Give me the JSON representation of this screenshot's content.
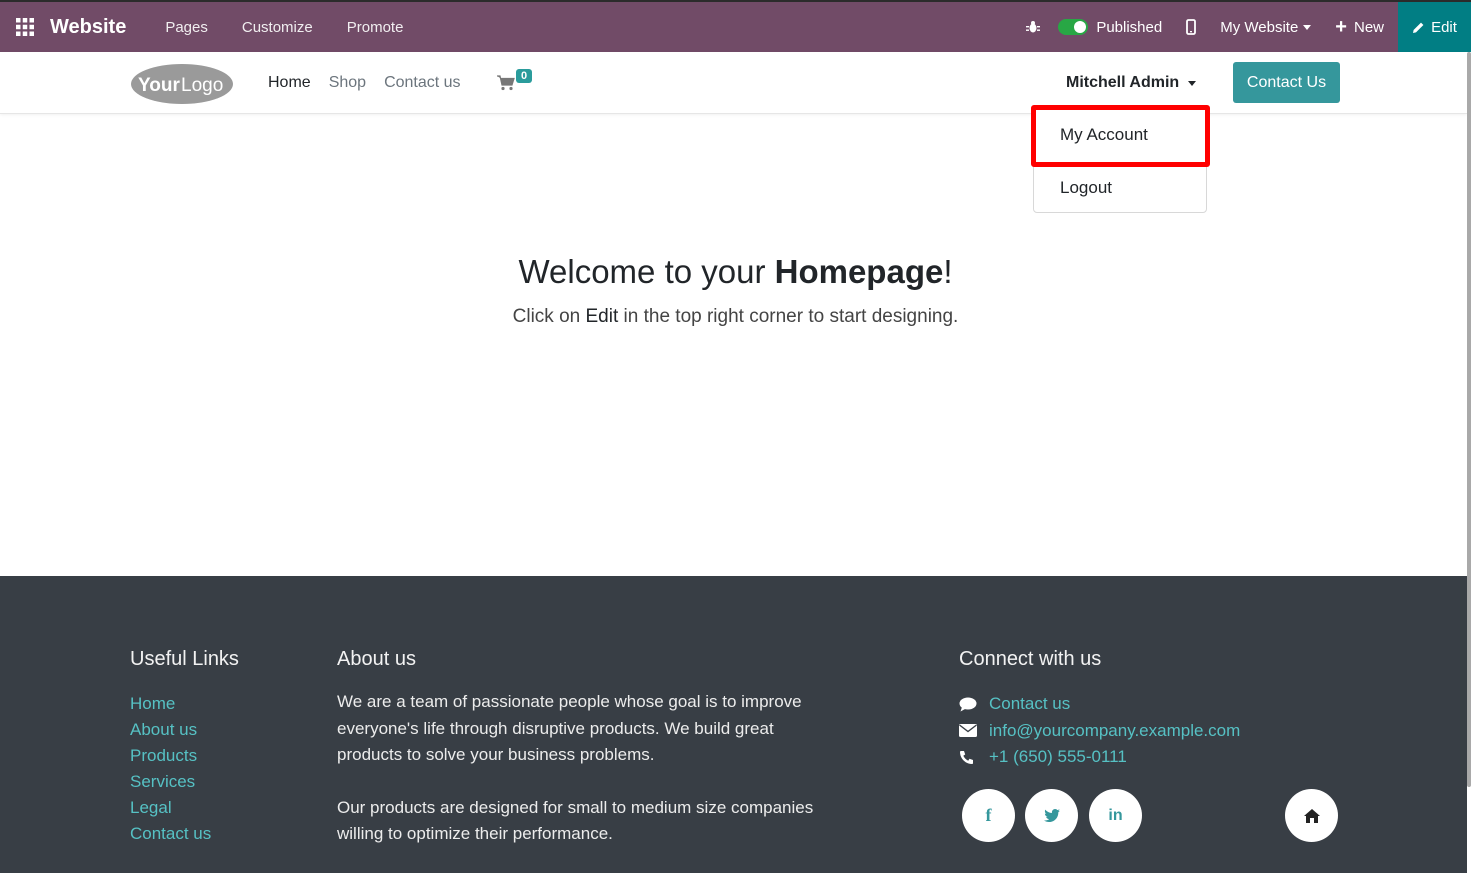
{
  "adminbar": {
    "brand": "Website",
    "menu": [
      "Pages",
      "Customize",
      "Promote"
    ],
    "published_label": "Published",
    "website_selector": "My Website",
    "new_label": "New",
    "edit_label": "Edit"
  },
  "header": {
    "logo_text": "YourLogo",
    "nav": [
      "Home",
      "Shop",
      "Contact us"
    ],
    "cart_count": "0",
    "user_name": "Mitchell Admin",
    "contact_button": "Contact Us"
  },
  "dropdown": {
    "items": [
      "My Account",
      "Logout"
    ]
  },
  "hero": {
    "title_prefix": "Welcome to your ",
    "title_bold": "Homepage",
    "title_suffix": "!",
    "sub_prefix": "Click on ",
    "sub_bold": "Edit",
    "sub_suffix": " in the top right corner to start designing."
  },
  "footer": {
    "useful_links_title": "Useful Links",
    "useful_links": [
      "Home",
      "About us",
      "Products",
      "Services",
      "Legal",
      "Contact us"
    ],
    "about_title": "About us",
    "about_p1": "We are a team of passionate people whose goal is to improve everyone's life through disruptive products. We build great products to solve your business problems.",
    "about_p2": "Our products are designed for small to medium size companies willing to optimize their performance.",
    "connect_title": "Connect with us",
    "connect_contact": "Contact us",
    "connect_email": "info@yourcompany.example.com",
    "connect_phone": "+1 (650) 555-0111",
    "social_icons": [
      "facebook-icon",
      "twitter-icon",
      "linkedin-icon",
      "home-icon"
    ]
  },
  "colors": {
    "adminbar": "#714B67",
    "edit_button": "#017e84",
    "accent": "#35979c",
    "footer_bg": "#383e45",
    "highlight": "#ff0000"
  }
}
